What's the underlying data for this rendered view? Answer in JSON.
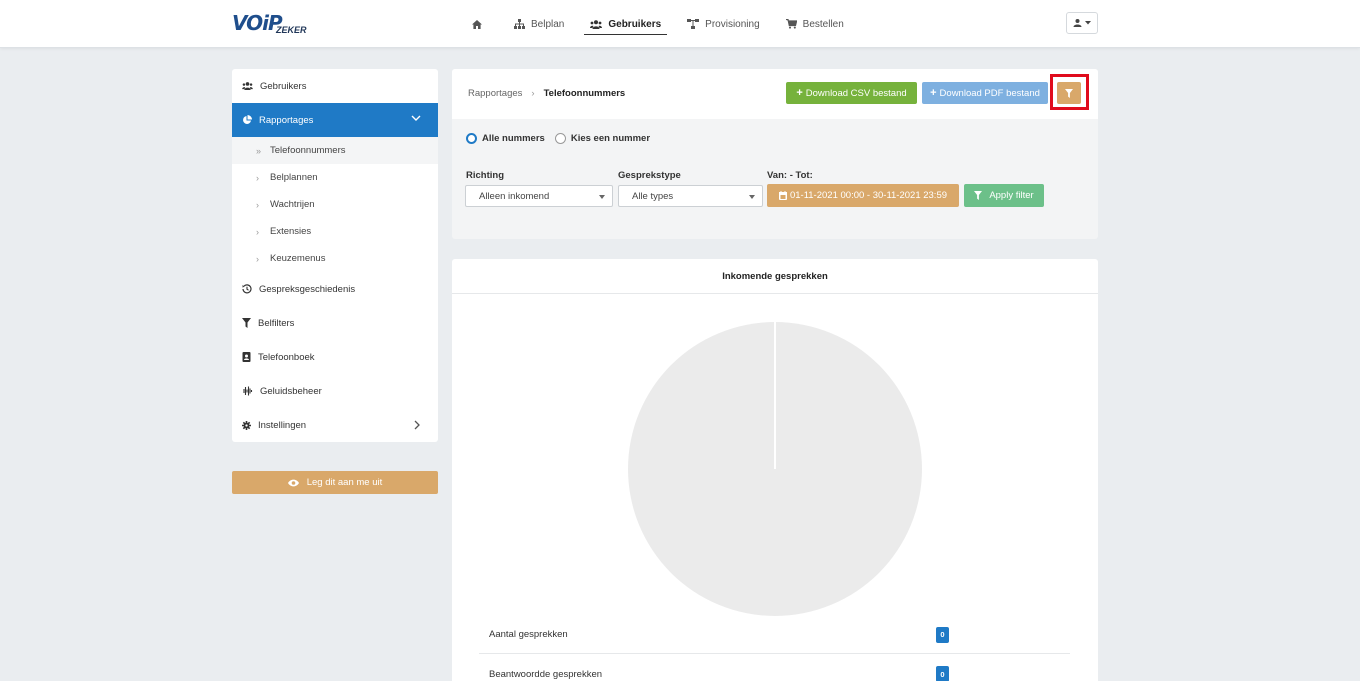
{
  "brand": {
    "logo_main": "VOiP",
    "logo_sub": "ZEKER"
  },
  "nav": {
    "items": [
      {
        "label": "",
        "icon": "home-icon"
      },
      {
        "label": "Belplan",
        "icon": "sitemap-icon"
      },
      {
        "label": "Gebruikers",
        "icon": "users-icon",
        "active": true
      },
      {
        "label": "Provisioning",
        "icon": "network-icon"
      },
      {
        "label": "Bestellen",
        "icon": "cart-icon"
      }
    ]
  },
  "sidebar": {
    "items": [
      {
        "label": "Gebruikers",
        "icon": "users-icon"
      },
      {
        "label": "Rapportages",
        "icon": "pie-chart-icon",
        "active": true
      },
      {
        "label": "Gespreksgeschiedenis",
        "icon": "history-icon"
      },
      {
        "label": "Belfilters",
        "icon": "filter-icon"
      },
      {
        "label": "Telefoonboek",
        "icon": "contact-book-icon"
      },
      {
        "label": "Geluidsbeheer",
        "icon": "waveform-icon"
      },
      {
        "label": "Instellingen",
        "icon": "gear-icon"
      }
    ],
    "subitems": [
      {
        "label": "Telefoonnummers",
        "current": true
      },
      {
        "label": "Belplannen"
      },
      {
        "label": "Wachtrijen"
      },
      {
        "label": "Extensies"
      },
      {
        "label": "Keuzemenus"
      }
    ],
    "explain_label": "Leg dit aan me uit"
  },
  "filter": {
    "breadcrumb": [
      "Rapportages",
      "Telefoonnummers"
    ],
    "download_csv": "Download CSV bestand",
    "download_pdf": "Download PDF bestand",
    "radio_all": "Alle nummers",
    "radio_choose": "Kies een nummer",
    "direction_label": "Richting",
    "direction_value": "Alleen inkomend",
    "calltype_label": "Gesprekstype",
    "calltype_value": "Alle types",
    "daterange_label": "Van: - Tot:",
    "daterange_value": "01-11-2021 00:00 - 30-11-2021 23:59",
    "apply_label": "Apply filter"
  },
  "report": {
    "title": "Inkomende gesprekken",
    "stats": [
      {
        "label": "Aantal gesprekken",
        "value": "0"
      },
      {
        "label": "Beantwoordde gesprekken",
        "value": "0"
      }
    ]
  },
  "colors": {
    "primary": "#1f7ac6",
    "csv_button": "#76b23c",
    "pdf_button": "#7eb0e0",
    "accent_tan": "#d9a86a",
    "apply_button": "#6cc089",
    "highlight": "#e00b1c",
    "pie_empty": "#ebebeb"
  }
}
